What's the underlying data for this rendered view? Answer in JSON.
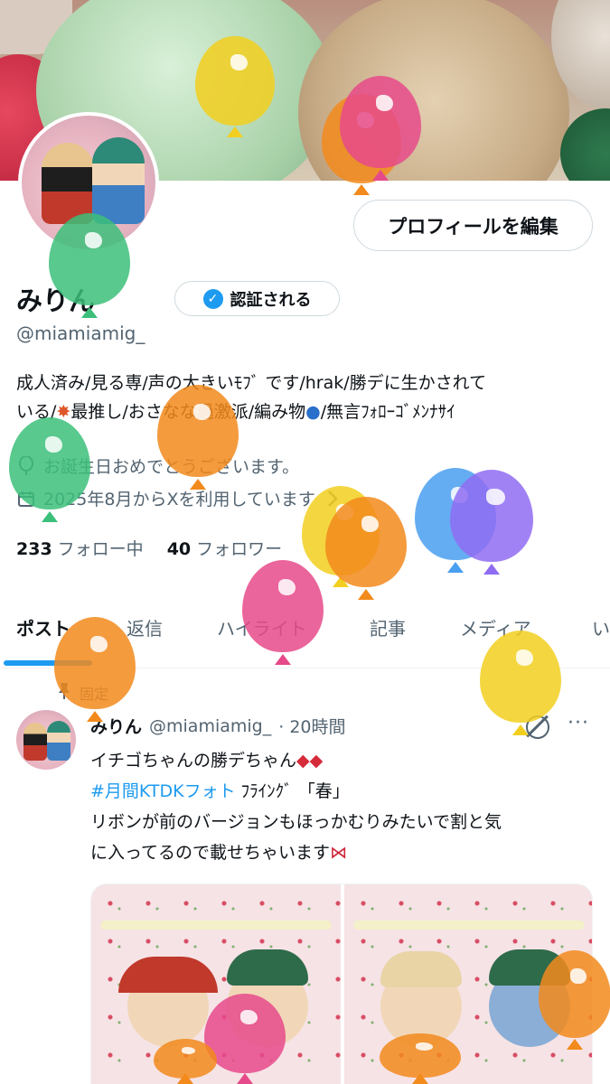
{
  "profile": {
    "edit_button": "プロフィールを編集",
    "name": "みりん",
    "verify_label": "認証される",
    "handle": "@miamiamig_",
    "bio_line1": "成人済み/見る専/声の大きいﾓﾌﾞ です/hrak/勝デに生かされて",
    "bio_line2_pre": "いる/",
    "bio_line2_mid": "最推し/おさなな過激派/編み物",
    "bio_line2_post": "/無言ﾌｫﾛｰｺﾞﾒﾝﾅｻｲ",
    "birthday": "お誕生日おめでとうございます。",
    "joined": "2025年8月からXを利用しています",
    "following_count": "233",
    "following_label": "フォロー中",
    "followers_count": "40",
    "followers_label": "フォロワー"
  },
  "tabs": [
    "ポスト",
    "返信",
    "ハイライト",
    "記事",
    "メディア",
    "い"
  ],
  "pinned_label": "固定",
  "post": {
    "author": "みりん",
    "handle": "@miamiamig_",
    "time": "· 20時間",
    "more": "···",
    "line1": "イチゴちゃんの勝デちゃん",
    "hashtag": "#月間KTDKフォト",
    "line2_rest": "ﾌﾗｲﾝｸﾞ 「春」",
    "line3": "リボンが前のバージョンもほっかむりみたいで割と気",
    "line4": "に入ってるので載せちゃいます"
  },
  "icons": {
    "verify": "verified-badge-icon",
    "balloon_pin": "balloon-icon",
    "calendar": "calendar-icon",
    "chevron": "chevron-right-icon",
    "pin": "pin-icon",
    "grok": "grok-icon",
    "more": "more-icon"
  },
  "colors": {
    "accent": "#1d9bf0",
    "text": "#0f1419",
    "secondary": "#536471"
  }
}
